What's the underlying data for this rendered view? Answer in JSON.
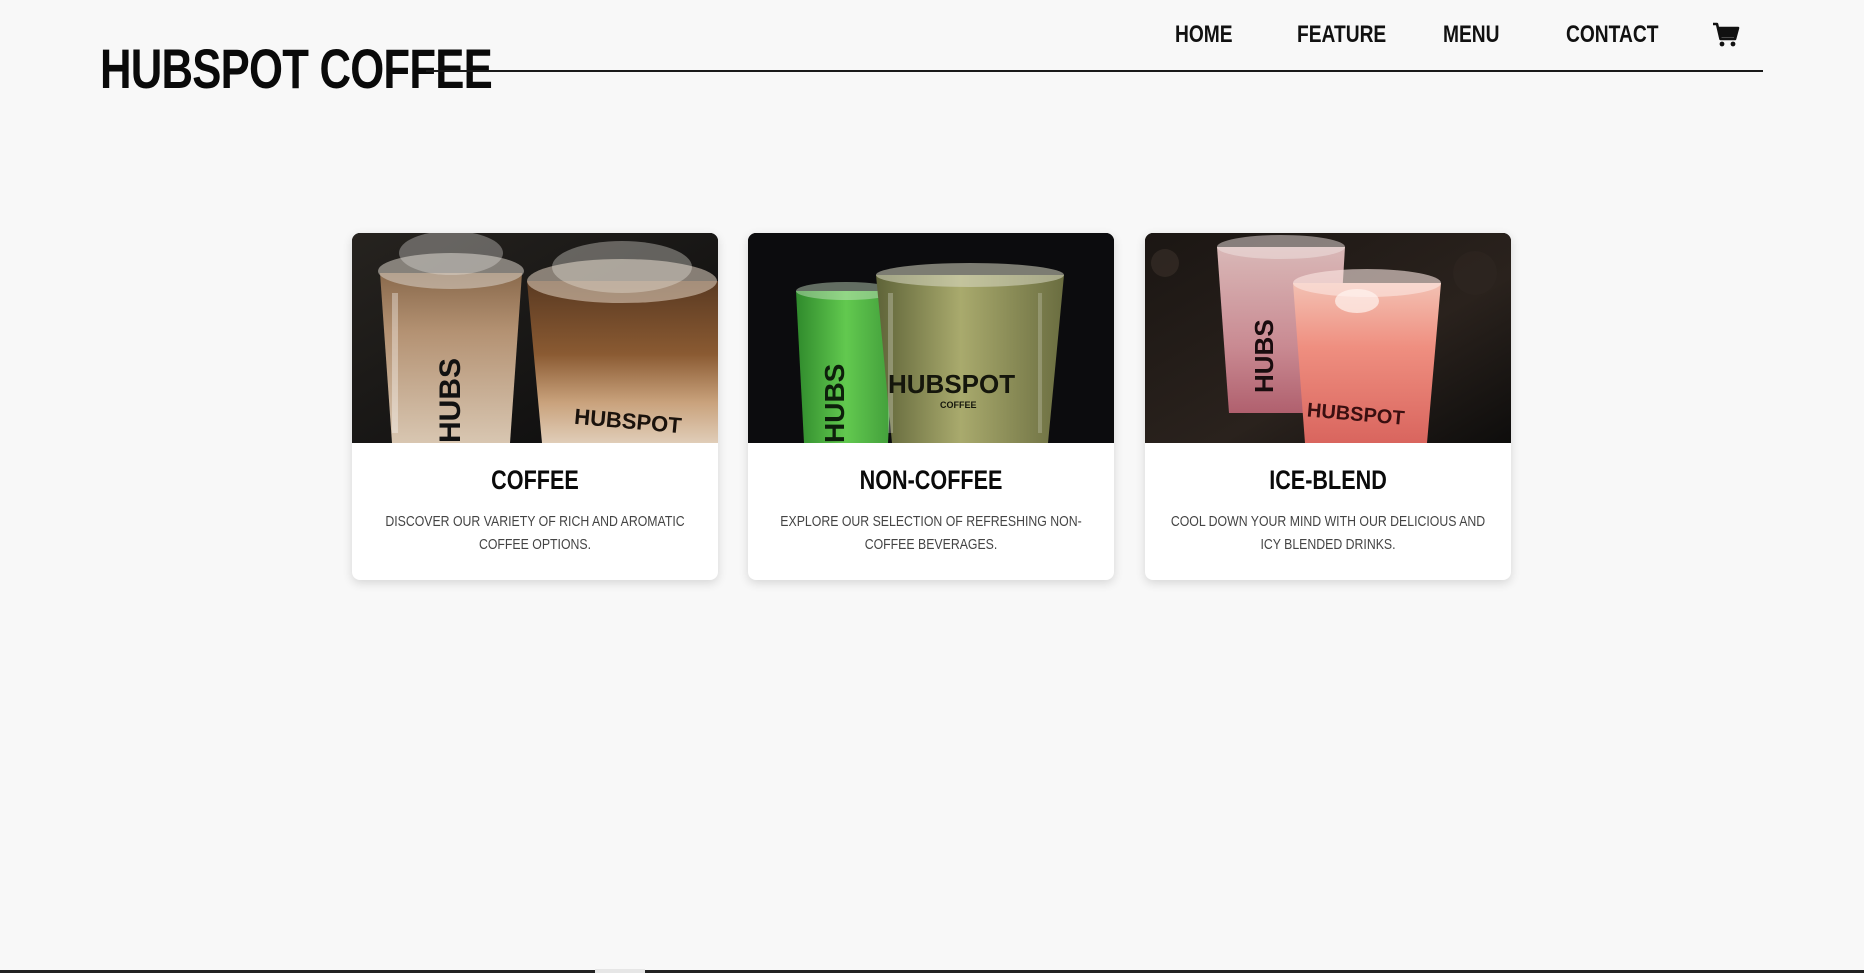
{
  "header": {
    "brand": "HUBSPOT COFFEE",
    "nav": [
      {
        "label": "HOME"
      },
      {
        "label": "FEATURE"
      },
      {
        "label": "MENU"
      },
      {
        "label": "CONTACT"
      }
    ],
    "cart_icon": "cart-icon"
  },
  "cards": [
    {
      "title": "COFFEE",
      "description": "DISCOVER OUR VARIETY OF RICH AND AROMATIC COFFEE OPTIONS.",
      "image": "coffee-drinks-image",
      "cup_label": "HUBSPOT",
      "cup_side_label": "HUBS"
    },
    {
      "title": "NON-COFFEE",
      "description": "EXPLORE OUR SELECTION OF REFRESHING NON-COFFEE BEVERAGES.",
      "image": "non-coffee-drinks-image",
      "cup_label": "HUBSPOT",
      "cup_sub_label": "COFFEE",
      "cup_side_label": "HUBS"
    },
    {
      "title": "ICE-BLEND",
      "description": "COOL DOWN YOUR MIND WITH OUR DELICIOUS AND ICY BLENDED DRINKS.",
      "image": "ice-blend-drinks-image",
      "cup_label": "HUBSPOT",
      "cup_side_label": "HUBS"
    }
  ],
  "colors": {
    "background": "#f8f8f8",
    "text": "#0a0a0a",
    "card": "#ffffff"
  }
}
